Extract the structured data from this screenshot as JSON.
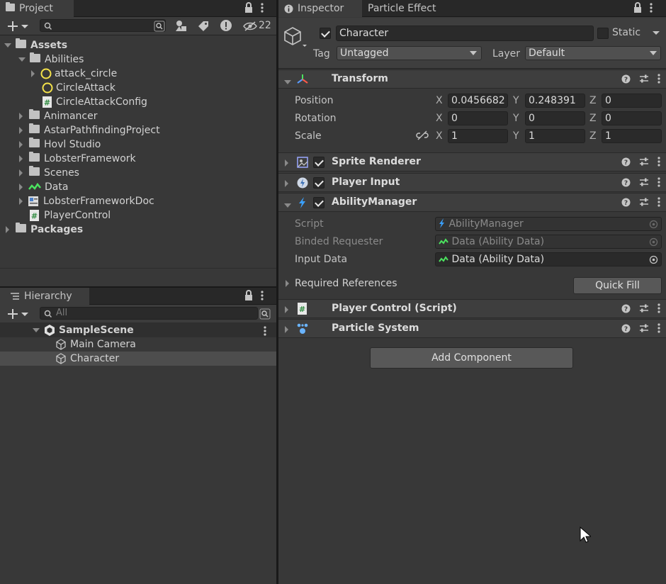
{
  "project": {
    "tab_label": "Project",
    "hidden_count": "22",
    "search_value": "",
    "tree": {
      "assets": "Assets",
      "abilities": "Abilities",
      "attack_circle": "attack_circle",
      "circle_attack": "CircleAttack",
      "circle_attack_config": "CircleAttackConfig",
      "animancer": "Animancer",
      "astar": "AstarPathfindingProject",
      "hovl": "Hovl Studio",
      "lobster": "LobsterFramework",
      "scenes": "Scenes",
      "data": "Data",
      "lobster_doc": "LobsterFrameworkDoc",
      "player_control": "PlayerControl",
      "packages": "Packages"
    }
  },
  "hierarchy": {
    "tab_label": "Hierarchy",
    "search_placeholder": "All",
    "scene": "SampleScene",
    "items": [
      "Main Camera",
      "Character"
    ]
  },
  "inspector": {
    "tab_label": "Inspector",
    "tab2_label": "Particle Effect",
    "object_name": "Character",
    "static_label": "Static",
    "tag_label": "Tag",
    "tag_value": "Untagged",
    "layer_label": "Layer",
    "layer_value": "Default",
    "transform": {
      "title": "Transform",
      "position_label": "Position",
      "rotation_label": "Rotation",
      "scale_label": "Scale",
      "x": "X",
      "y": "Y",
      "z": "Z",
      "position": [
        "0.0456682",
        "0.248391",
        "0"
      ],
      "rotation": [
        "0",
        "0",
        "0"
      ],
      "scale": [
        "1",
        "1",
        "1"
      ]
    },
    "components": {
      "sprite_renderer": "Sprite Renderer",
      "player_input": "Player Input",
      "ability_manager": "AbilityManager",
      "player_control": "Player Control (Script)",
      "particle_system": "Particle System"
    },
    "ability_manager": {
      "script_label": "Script",
      "script_value": "AbilityManager",
      "binded_label": "Binded Requester",
      "binded_value": "Data (Ability Data)",
      "input_label": "Input Data",
      "input_value": "Data (Ability Data)",
      "required_label": "Required References",
      "quick_fill": "Quick Fill"
    },
    "add_component": "Add Component"
  },
  "colors": {
    "panel_bg": "#383838",
    "tab_bar": "#282828",
    "selection": "#4d4d4d",
    "data_icon": "#4be35f",
    "script_icon": "#7fd1ff",
    "gizmo_yellow": "#f5e34a"
  }
}
